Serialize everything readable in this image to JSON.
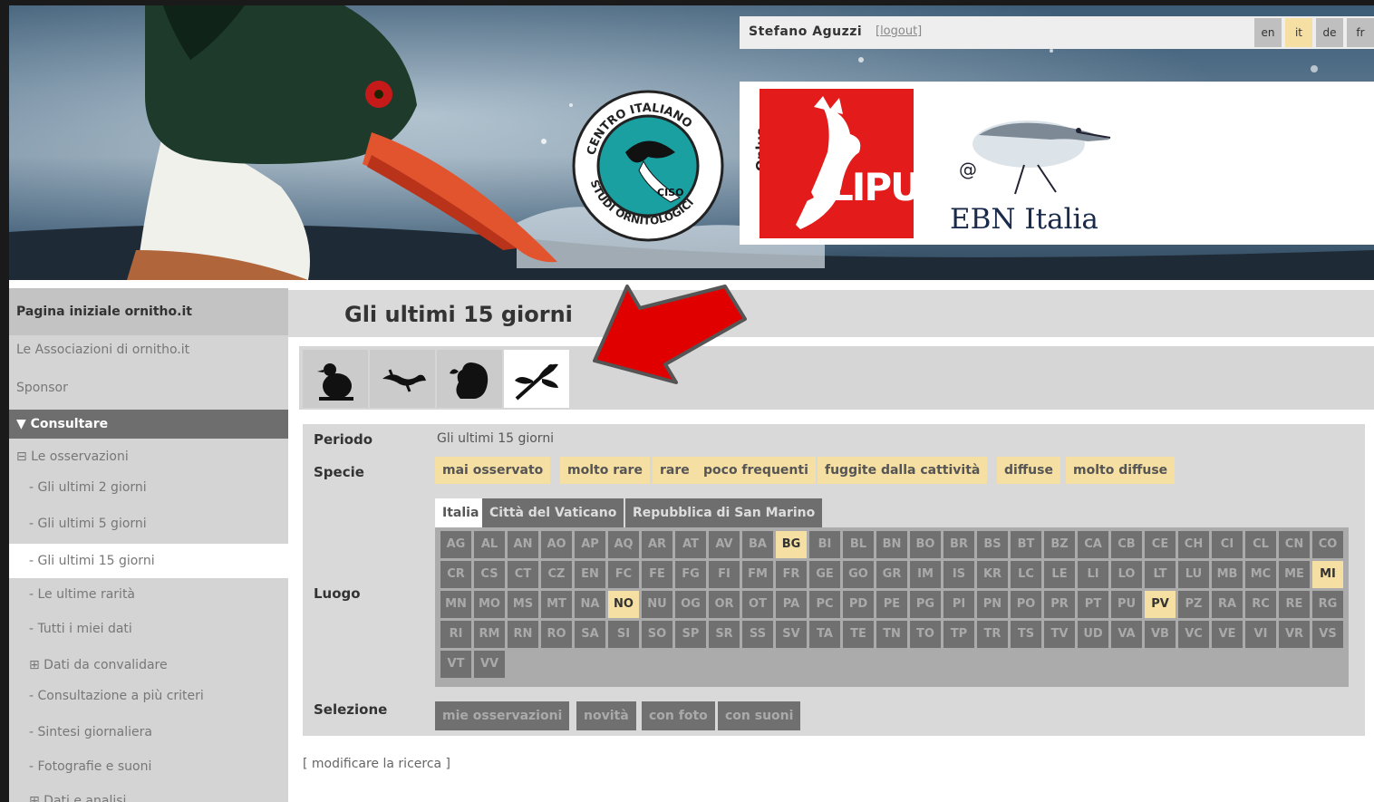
{
  "header": {
    "user_name": "Stefano Aguzzi",
    "logout": "[logout]",
    "languages": [
      "en",
      "it",
      "de",
      "fr"
    ],
    "active_language": "it",
    "logos": {
      "ciso_ring_text_top": "CENTRO ITALIANO",
      "ciso_ring_text_bottom": "STUDI ORNITOLOGICI",
      "ciso_center": "CISO",
      "onlus": "Onlus",
      "lipu": "LIPU",
      "ebn": "EBN Italia"
    }
  },
  "sidebar": {
    "items": [
      {
        "label": "Pagina iniziale ornitho.it"
      },
      {
        "label": "Le Associazioni di ornitho.it"
      },
      {
        "label": "Sponsor"
      },
      {
        "label": "▼ Consultare"
      },
      {
        "label": "⊟ Le osservazioni"
      },
      {
        "label": "- Gli ultimi 2 giorni"
      },
      {
        "label": "- Gli ultimi 5 giorni"
      },
      {
        "label": "- Gli ultimi 15 giorni"
      },
      {
        "label": "- Le ultime rarità"
      },
      {
        "label": "- Tutti i miei dati"
      },
      {
        "label": "⊞ Dati da convalidare"
      },
      {
        "label": "- Consultazione a più criteri"
      },
      {
        "label": "- Sintesi giornaliera"
      },
      {
        "label": "- Fotografie e suoni"
      },
      {
        "label": "⊞ Dati e analisi"
      }
    ]
  },
  "main": {
    "title": "Gli ultimi 15 giorni",
    "taxon_tabs": [
      "bird-icon",
      "lizard-icon",
      "squirrel-icon",
      "dragonfly-icon"
    ],
    "active_tab": "dragonfly-icon",
    "labels": {
      "period": "Periodo",
      "species": "Specie",
      "place": "Luogo",
      "selection": "Selezione"
    },
    "period_value": "Gli ultimi 15 giorni",
    "species_chips": [
      "mai osservato",
      "molto rare",
      "rare",
      "poco frequenti",
      "fuggite dalla cattività",
      "diffuse",
      "molto diffuse"
    ],
    "country_tabs": [
      "Italia",
      "Città del Vaticano",
      "Repubblica di San Marino"
    ],
    "active_country": "Italia",
    "provinces": [
      [
        "AG",
        "AL",
        "AN",
        "AO",
        "AP",
        "AQ",
        "AR",
        "AT",
        "AV",
        "BA",
        "BG",
        "BI",
        "BL",
        "BN",
        "BO",
        "BR",
        "BS",
        "BT",
        "BZ",
        "CA",
        "CB",
        "CE",
        "CH",
        "CI",
        "CL",
        "CN",
        "CO"
      ],
      [
        "CR",
        "CS",
        "CT",
        "CZ",
        "EN",
        "FC",
        "FE",
        "FG",
        "FI",
        "FM",
        "FR",
        "GE",
        "GO",
        "GR",
        "IM",
        "IS",
        "KR",
        "LC",
        "LE",
        "LI",
        "LO",
        "LT",
        "LU",
        "MB",
        "MC",
        "ME",
        "MI"
      ],
      [
        "MN",
        "MO",
        "MS",
        "MT",
        "NA",
        "NO",
        "NU",
        "OG",
        "OR",
        "OT",
        "PA",
        "PC",
        "PD",
        "PE",
        "PG",
        "PI",
        "PN",
        "PO",
        "PR",
        "PT",
        "PU",
        "PV",
        "PZ",
        "RA",
        "RC",
        "RE",
        "RG"
      ],
      [
        "RI",
        "RM",
        "RN",
        "RO",
        "SA",
        "SI",
        "SO",
        "SP",
        "SR",
        "SS",
        "SV",
        "TA",
        "TE",
        "TN",
        "TO",
        "TP",
        "TR",
        "TS",
        "TV",
        "UD",
        "VA",
        "VB",
        "VC",
        "VE",
        "VI",
        "VR",
        "VS"
      ],
      [
        "VT",
        "VV"
      ]
    ],
    "highlighted_provinces": [
      "BG",
      "MI",
      "NO",
      "PV"
    ],
    "selection_buttons": [
      "mie osservazioni",
      "novità",
      "con foto",
      "con suoni"
    ],
    "modify_link": "[ modificare la ricerca ]"
  },
  "colors": {
    "highlight": "#f6dfa2",
    "dark_cell": "#707070",
    "arrow": "#e00000",
    "lipu_red": "#e31b1b"
  }
}
